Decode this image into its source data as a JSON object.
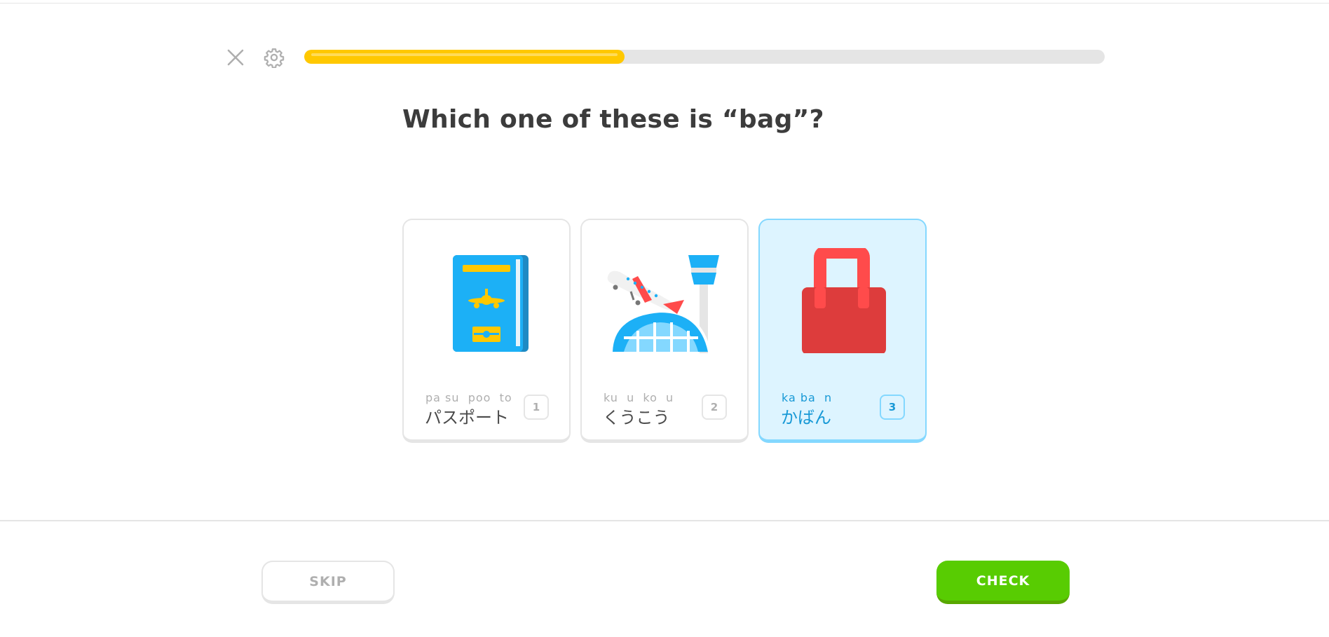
{
  "header": {
    "close_icon": "close-icon",
    "settings_icon": "gear-icon",
    "progress": {
      "value": 0.4
    }
  },
  "question": {
    "prompt": "Which one of these is “bag”?"
  },
  "choices": [
    {
      "romaji": "pa su  poo  to",
      "kana": "パスポート",
      "key": "1",
      "image": "passport-image",
      "selected": false
    },
    {
      "romaji": "ku  u  ko  u",
      "kana": "くうこう",
      "key": "2",
      "image": "airport-image",
      "selected": false
    },
    {
      "romaji": "ka ba  n",
      "kana": "かばん",
      "key": "3",
      "image": "bag-image",
      "selected": true
    }
  ],
  "footer": {
    "skip_label": "SKIP",
    "check_label": "CHECK"
  },
  "colors": {
    "progress_fill": "#ffc800",
    "selected_bg": "#ddf4ff",
    "selected_border": "#84d8ff",
    "selected_text": "#1899d6",
    "check_button": "#58cc02"
  }
}
